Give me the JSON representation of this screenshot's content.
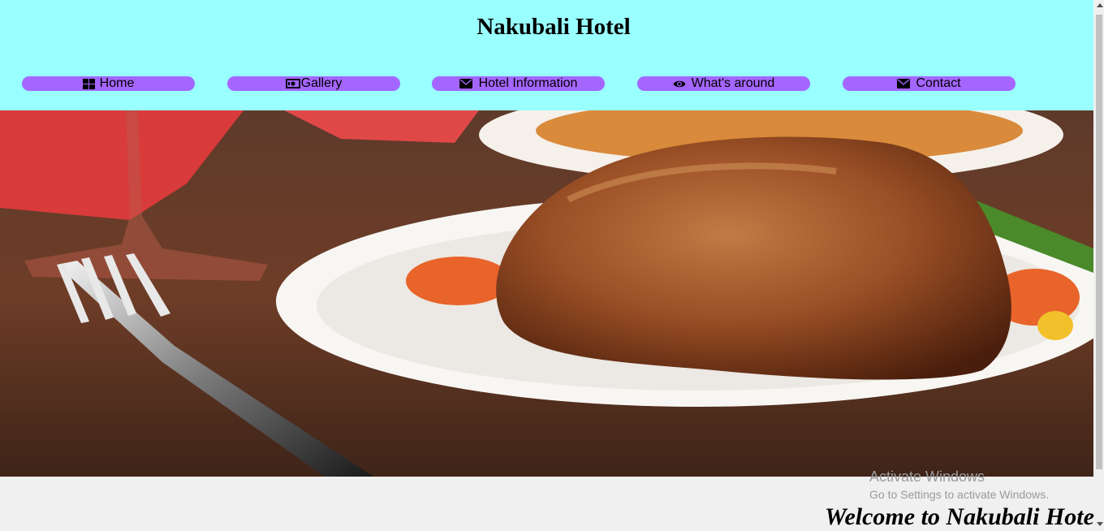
{
  "header": {
    "title": "Nakubali Hotel",
    "background": "#99ffff"
  },
  "nav": {
    "accent": "#a566ff",
    "items": [
      {
        "label": "Home",
        "icon": "th-large-icon"
      },
      {
        "label": "Gallery",
        "icon": "money-bill-icon"
      },
      {
        "label": "Hotel Information",
        "icon": "envelope-icon"
      },
      {
        "label": "What's around",
        "icon": "eye-icon"
      },
      {
        "label": "Contact",
        "icon": "envelope-icon"
      }
    ]
  },
  "hero": {
    "image": "roast-chicken-plate-photo"
  },
  "welcome": {
    "text": "Welcome to Nakubali Hote"
  },
  "watermark": {
    "title": "Activate Windows",
    "subtitle": "Go to Settings to activate Windows."
  }
}
